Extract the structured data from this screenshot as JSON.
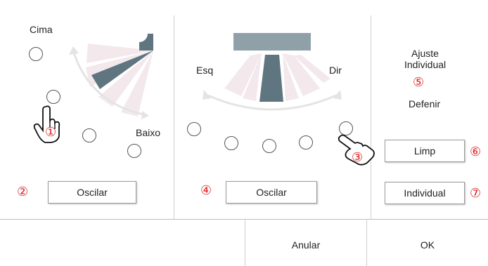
{
  "vertical_panel": {
    "top_label": "Cima",
    "bottom_label": "Baixo",
    "swing_button": "Oscilar",
    "marker_swing": "②",
    "marker_step": "①"
  },
  "horizontal_panel": {
    "left_label": "Esq",
    "right_label": "Dir",
    "swing_button": "Oscilar",
    "marker_swing": "④",
    "marker_step": "③"
  },
  "individual_panel": {
    "title_line1": "Ajuste",
    "title_line2": "Individual",
    "marker_title": "⑤",
    "define_label": "Defenir",
    "clear_button": "Limp",
    "marker_clear": "⑥",
    "individual_button": "Individual",
    "marker_individual": "⑦"
  },
  "footer": {
    "cancel_button": "Anular",
    "ok_button": "OK"
  },
  "colors": {
    "vane_active": "#5f7580",
    "vane_inactive": "#f2e6ea",
    "marker": "#dd2222"
  }
}
